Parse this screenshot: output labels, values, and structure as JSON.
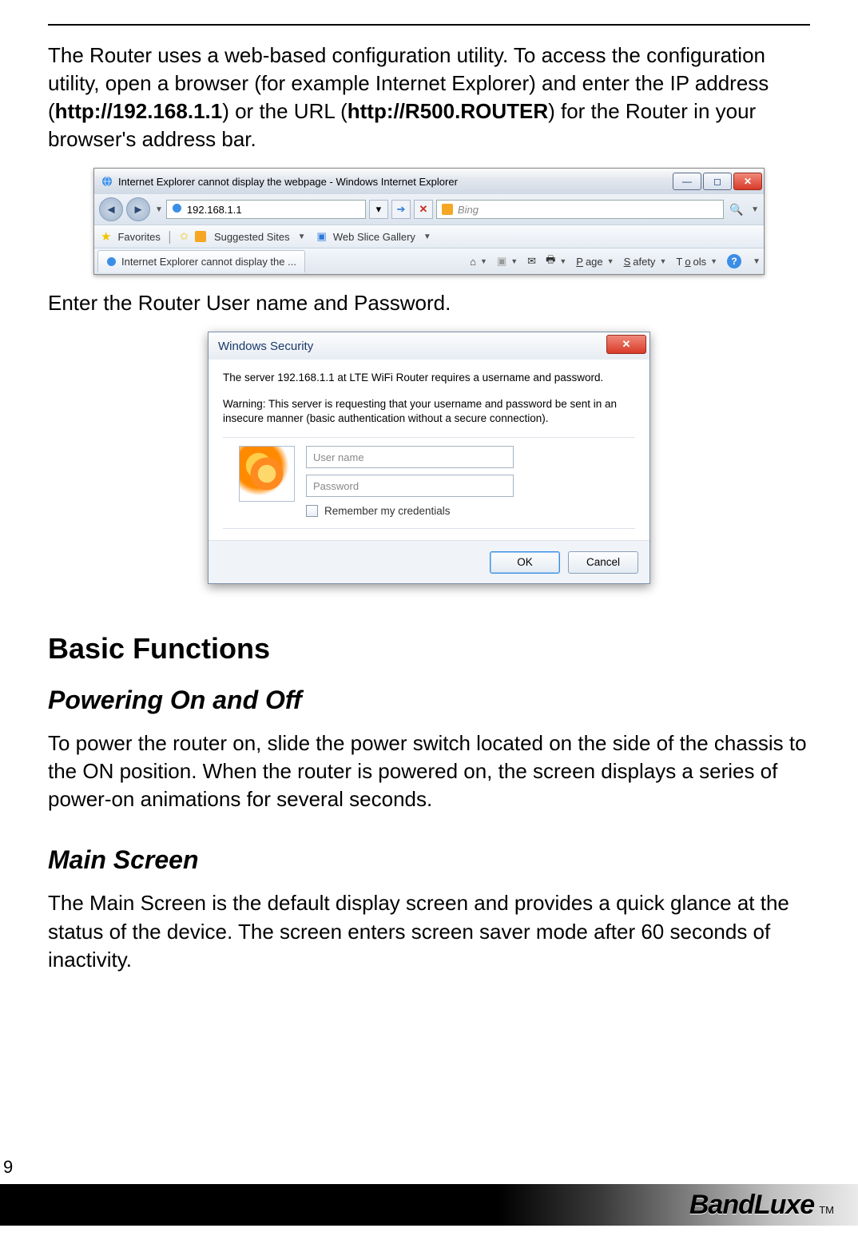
{
  "intro": {
    "line1_a": "The Router uses a web-based configuration utility. To access the configuration utility, open a browser (for example Internet Explorer) and enter the IP address (",
    "ip_bold": "http://192.168.1.1",
    "line1_b": ") or the URL (",
    "url_bold": "http://R500.ROUTER",
    "line1_c": ") for the Router in your browser's address bar."
  },
  "ie": {
    "title": "Internet Explorer cannot display the webpage - Windows Internet Explorer",
    "address": "192.168.1.1",
    "search_provider": "Bing",
    "fav_label": "Favorites",
    "suggested": "Suggested Sites",
    "webslice": "Web Slice Gallery",
    "tab_label": "Internet Explorer cannot display the ...",
    "menu_page": "Page",
    "menu_safety": "Safety",
    "menu_tools": "Tools"
  },
  "mid_text": "Enter the Router User name and Password.",
  "security": {
    "title": "Windows Security",
    "msg1": "The server 192.168.1.1 at LTE WiFi Router requires a username and password.",
    "msg2": "Warning: This server is requesting that your username and password be sent in an insecure manner (basic authentication without a secure connection).",
    "user_placeholder": "User name",
    "pass_placeholder": "Password",
    "remember": "Remember my credentials",
    "ok": "OK",
    "cancel": "Cancel"
  },
  "sections": {
    "basic": "Basic Functions",
    "power_h": "Powering On and Off",
    "power_body": "To power the router on, slide the power switch located on the side of the chassis to the ON position. When the router is powered on, the screen displays a series of power-on animations for several seconds.",
    "main_h": "Main Screen",
    "main_body": "The Main Screen is the default display screen and provides a quick glance at the status of the device. The screen enters screen saver mode after 60 seconds of inactivity."
  },
  "footer": {
    "page_num": "9",
    "brand": "BandLuxe",
    "tm": "TM"
  }
}
